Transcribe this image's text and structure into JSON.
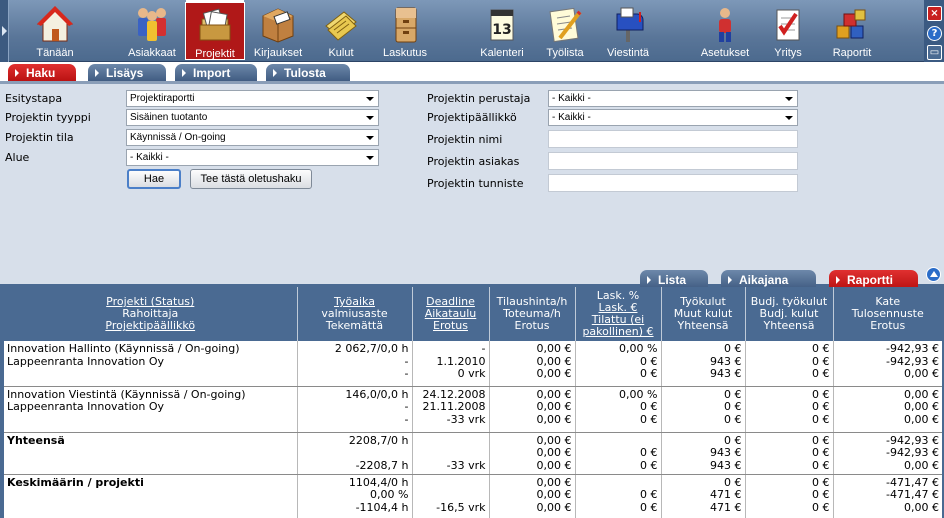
{
  "toolbar": {
    "items": [
      {
        "label": "Tänään",
        "icon": "home-icon"
      },
      {
        "label": "Asiakkaat",
        "icon": "customers-icon"
      },
      {
        "label": "Projektit",
        "icon": "projects-icon",
        "active": true
      },
      {
        "label": "Kirjaukset",
        "icon": "entries-icon"
      },
      {
        "label": "Kulut",
        "icon": "expenses-icon"
      },
      {
        "label": "Laskutus",
        "icon": "invoicing-icon"
      },
      {
        "label": "Kalenteri",
        "icon": "calendar-icon"
      },
      {
        "label": "Työlista",
        "icon": "tasklist-icon"
      },
      {
        "label": "Viestintä",
        "icon": "mailbox-icon"
      },
      {
        "label": "Asetukset",
        "icon": "settings-icon"
      },
      {
        "label": "Yritys",
        "icon": "company-icon"
      },
      {
        "label": "Raportit",
        "icon": "reports-icon"
      }
    ],
    "window_controls": {
      "close": "×",
      "help": "?",
      "minimize": "▭"
    }
  },
  "subtabs": {
    "haku": "Haku",
    "lisays": "Lisäys",
    "import": "Import",
    "tulosta": "Tulosta"
  },
  "form": {
    "esitystapa_label": "Esitystapa",
    "esitystapa_value": "Projektiraportti",
    "tyyppi_label": "Projektin tyyppi",
    "tyyppi_value": "Sisäinen tuotanto",
    "tila_label": "Projektin tila",
    "tila_value": "Käynnissä / On-going",
    "alue_label": "Alue",
    "alue_value": "- Kaikki -",
    "perustaja_label": "Projektin perustaja",
    "perustaja_value": "- Kaikki -",
    "paallikko_label": "Projektipäällikkö",
    "paallikko_value": "- Kaikki -",
    "nimi_label": "Projektin nimi",
    "asiakas_label": "Projektin asiakas",
    "tunniste_label": "Projektin tunniste",
    "hae_button": "Hae",
    "oletushaku_button": "Tee tästä oletushaku"
  },
  "view_tabs": {
    "lista": "Lista",
    "aikajana": "Aikajana",
    "raportti": "Raportti"
  },
  "table": {
    "headers": {
      "c1_l1": "Projekti (Status)",
      "c1_l2": "Rahoittaja",
      "c1_l3": "Projektipäällikkö",
      "c2_l1": "Työaika",
      "c2_l2": "valmiusaste",
      "c2_l3": "Tekemättä",
      "c3_l1": "Deadline",
      "c3_l2": "Aikataulu",
      "c3_l3": "Erotus",
      "c4_l1": "Tilaushinta/h",
      "c4_l2": "Toteuma/h",
      "c4_l3": "Erotus",
      "c5_l1": "Lask. %",
      "c5_l2": "Lask. €",
      "c5_l3": "Tilattu (ei",
      "c5_l4": "pakollinen) €",
      "c6_l1": "Työkulut",
      "c6_l2": "Muut kulut",
      "c6_l3": "Yhteensä",
      "c7_l1": "Budj. työkulut",
      "c7_l2": "Budj. kulut",
      "c7_l3": "Yhteensä",
      "c8_l1": "Kate",
      "c8_l2": "Tulosennuste",
      "c8_l3": "Erotus"
    },
    "rows": [
      {
        "project": "Innovation Hallinto (Käynnissä / On-going)\nLappeenranta Innovation Oy",
        "tyoaika": "2 062,7/0,0 h\n-\n-",
        "deadline": "-\n1.1.2010\n0 vrk",
        "tilaushinta": "0,00 €\n0,00 €\n0,00 €",
        "lask": "0,00 %\n0 €\n0 €",
        "tyokulut": "0 €\n943 €\n943 €",
        "budj": "0 €\n0 €\n0 €",
        "kate": "-942,93 €\n-942,93 €\n0,00 €"
      },
      {
        "project": "Innovation Viestintä (Käynnissä / On-going)\nLappeenranta Innovation Oy",
        "tyoaika": "146,0/0,0 h\n-\n-",
        "deadline": "24.12.2008\n21.11.2008\n-33 vrk",
        "tilaushinta": "0,00 €\n0,00 €\n0,00 €",
        "lask": "0,00 %\n0 €\n0 €",
        "tyokulut": "0 €\n0 €\n0 €",
        "budj": "0 €\n0 €\n0 €",
        "kate": "0,00 €\n0,00 €\n0,00 €"
      },
      {
        "project": "Yhteensä",
        "tyoaika": "2208,7/0 h\n\n-2208,7 h",
        "deadline": "\n\n-33 vrk",
        "tilaushinta": "0,00 €\n0,00 €\n0,00 €",
        "lask": "\n0 €\n0 €",
        "tyokulut": "0 €\n943 €\n943 €",
        "budj": "0 €\n0 €\n0 €",
        "kate": "-942,93 €\n-942,93 €\n0,00 €"
      },
      {
        "project": "Keskimäärin / projekti",
        "tyoaika": "1104,4/0 h\n0,00 %\n-1104,4 h",
        "deadline": "\n\n-16,5 vrk",
        "tilaushinta": "0,00 €\n0,00 €\n0,00 €",
        "lask": "\n0 €\n0 €",
        "tyokulut": "0 €\n471 €\n471 €",
        "budj": "0 €\n0 €\n0 €",
        "kate": "-471,47 €\n-471,47 €\n0,00 €"
      }
    ]
  }
}
